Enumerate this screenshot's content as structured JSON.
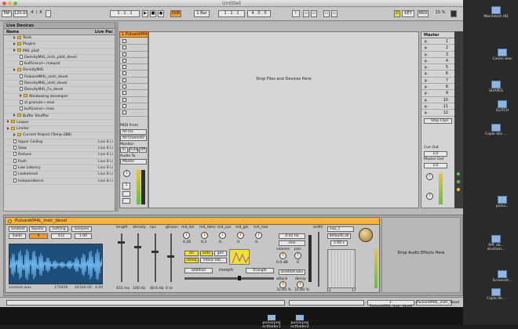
{
  "window": {
    "title": "Untitled"
  },
  "transport": {
    "tap": "TAP",
    "tempo": "120.00",
    "sig_num": "4",
    "sig_den": "4",
    "pos": "1 . 1 . 1",
    "ovr": "OVR",
    "quant": "1 Bar",
    "loop_pos": "1 . 1 . 1",
    "loop_len": "4 . 0 . 0",
    "key": "KEY",
    "midi": "MIDI",
    "cpu": "15 %",
    "mode": "D"
  },
  "browser": {
    "header": "Name",
    "header_right": "Live Pac",
    "title": "Live Devices",
    "rows": [
      {
        "name": "Tools",
        "indent": 1,
        "kind": "folder",
        "v": ""
      },
      {
        "name": "Plugins",
        "indent": 1,
        "kind": "folder",
        "v": ""
      },
      {
        "name": "M4L pilot",
        "indent": 1,
        "kind": "folder",
        "v": ""
      },
      {
        "name": "DensityM4L_instr_pilot_devel",
        "indent": 2,
        "kind": "doc",
        "v": ""
      },
      {
        "name": "bufGranul~.maxpat",
        "indent": 2,
        "kind": "doc",
        "v": ""
      },
      {
        "name": "DensityM4L",
        "indent": 1,
        "kind": "folder",
        "v": ""
      },
      {
        "name": "PulsaretM4L_instr_devel",
        "indent": 2,
        "kind": "doc",
        "v": ""
      },
      {
        "name": "DensityM4L_instr_devel",
        "indent": 2,
        "kind": "doc",
        "v": ""
      },
      {
        "name": "DensityM4L_Fx_devel",
        "indent": 2,
        "kind": "doc",
        "v": ""
      },
      {
        "name": "Windowing developer",
        "indent": 2,
        "kind": "folder",
        "v": ""
      },
      {
        "name": "st.granule~.mxo",
        "indent": 2,
        "kind": "doc",
        "v": ""
      },
      {
        "name": "bufGranul~.mxo",
        "indent": 2,
        "kind": "doc",
        "v": ""
      },
      {
        "name": "Buffer Shuffler",
        "indent": 1,
        "kind": "folder",
        "v": ""
      },
      {
        "name": "Looper",
        "indent": 0,
        "kind": "folder",
        "v": ""
      },
      {
        "name": "Limiter",
        "indent": 0,
        "kind": "folder",
        "v": ""
      },
      {
        "name": "Current Project (Temp-288)",
        "indent": 1,
        "kind": "folder",
        "v": ""
      },
      {
        "name": "Upper Ceiling",
        "indent": 1,
        "kind": "doc",
        "v": "Live 8 Li"
      },
      {
        "name": "Slow",
        "indent": 1,
        "kind": "doc",
        "v": "Live 8 Li"
      },
      {
        "name": "Reduce",
        "indent": 1,
        "kind": "doc",
        "v": "Live 8 Li"
      },
      {
        "name": "Push",
        "indent": 1,
        "kind": "doc",
        "v": "Live 8 Li"
      },
      {
        "name": "Low Latency",
        "indent": 1,
        "kind": "doc",
        "v": "Live 8 Li"
      },
      {
        "name": "Lookahead",
        "indent": 1,
        "kind": "doc",
        "v": "Live 8 Li"
      },
      {
        "name": "Independence",
        "indent": 1,
        "kind": "doc",
        "v": "Live 8 Li"
      }
    ]
  },
  "track": {
    "name": "1 PulsaretM4",
    "midi_from": "MIDI From",
    "midi_from_val": "All Ins",
    "channel": "All Channels",
    "monitor": "Monitor",
    "mon_in": "In",
    "mon_auto": "Auto",
    "mon_off": "Off",
    "audio_to": "Audio To",
    "audio_to_val": "Master",
    "number": "1"
  },
  "session": {
    "drop_hint": "Drop Files and Devices Here"
  },
  "master": {
    "title": "Master",
    "scenes": [
      "1",
      "2",
      "3",
      "4",
      "5",
      "6",
      "7",
      "8",
      "9",
      "10",
      "11",
      "12"
    ],
    "stop_clips": "Stop Clips",
    "cue_out": "Cue Out",
    "cue_val": "1/2",
    "master_out": "Master Out",
    "master_val": "1/2"
  },
  "device": {
    "title": "PulsaretM4L_instr_devel",
    "wave_opts": [
      "sinetest",
      "bipolar",
      "nothing",
      "samples"
    ],
    "load_btn": "loadir",
    "num1": "0",
    "num2": "512",
    "num3": "1.00",
    "wave_info": [
      "sinetest.wav",
      "176400",
      "44100.00",
      "4.00"
    ],
    "col_labels": [
      "length",
      "density",
      "cps",
      "glisson",
      "md_len",
      "md_dens",
      "md_cps",
      "md_gls",
      "md_mor"
    ],
    "knob_vals": [
      "0.26",
      "0.3",
      "0.",
      "0.",
      "0."
    ],
    "fader_vals": [
      "431 ms",
      "100 Hz",
      "40.6 Hz",
      "0 st"
    ],
    "morph": {
      "ori": "ori",
      "auto": "auto",
      "gen": "gen",
      "interp": "interp",
      "interp_tab": "interp tab...",
      "additive": "additive",
      "morph": "morph",
      "triangle": "triangle"
    },
    "freq": "0.02 Hz",
    "wave": "sine",
    "sinetest": "sinetest.wav",
    "volume": "volume",
    "vol_val": "0.0 dB",
    "pan": "pan",
    "pan_val": "0",
    "attack": "attack",
    "att_val": "31.00 %",
    "decay": "decay",
    "dec_val": "31.00 %",
    "width": "width",
    "window": "exp_1",
    "defaults": "defaults.all",
    "time": "2.00 s",
    "scale_a": "12",
    "scale_b": "17"
  },
  "fx": {
    "hint": "Drop Audio Effects Here"
  },
  "status": {
    "clip1": "1-PulsaretM4L_instr_devel",
    "clip2": "PulsaretM4L_instr_devel"
  },
  "desktop": [
    "Macintosh HD",
    "Canon.wav",
    "SHAPES",
    "GLITCH",
    "Copie des ...",
    "pulsa...",
    "APF da... studiam...",
    "Screensh...",
    "Copie de...",
    "Macro..."
  ],
  "dock": [
    "pulsarproj ectfolder1",
    "pulsarproj ectfolder2"
  ]
}
